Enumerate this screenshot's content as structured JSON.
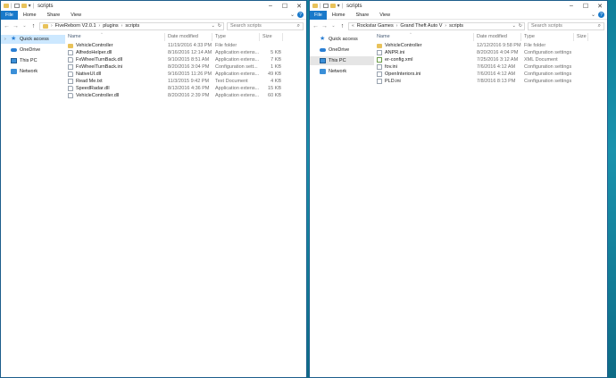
{
  "left": {
    "title": "scripts",
    "tabs": [
      "File",
      "Home",
      "Share",
      "View"
    ],
    "breadcrumb": [
      "FiveReborn V2.0.1",
      "plugins",
      "scripts"
    ],
    "search_placeholder": "Search scripts",
    "nav": [
      {
        "label": "Quick access",
        "icon": "star-icon"
      },
      {
        "label": "OneDrive",
        "icon": "cloud-icon"
      },
      {
        "label": "This PC",
        "icon": "computer-icon"
      },
      {
        "label": "Network",
        "icon": "network-icon"
      }
    ],
    "columns": [
      "Name",
      "Date modified",
      "Type",
      "Size"
    ],
    "files": [
      {
        "name": "VehicleController",
        "date": "11/19/2016 4:33 PM",
        "type": "File folder",
        "size": "",
        "icon": "folder"
      },
      {
        "name": "AlfredoHelper.dll",
        "date": "8/16/2016 12:14 AM",
        "type": "Application extens...",
        "size": "5 KB",
        "icon": "gear"
      },
      {
        "name": "FxWheelTurnBack.dll",
        "date": "9/10/2015 8:51 AM",
        "type": "Application extens...",
        "size": "7 KB",
        "icon": "gear"
      },
      {
        "name": "FxWheelTurnBack.ini",
        "date": "8/20/2016 3:04 PM",
        "type": "Configuration sett...",
        "size": "1 KB",
        "icon": "doc"
      },
      {
        "name": "NativeUI.dll",
        "date": "9/16/2015 11:26 PM",
        "type": "Application extens...",
        "size": "49 KB",
        "icon": "gear"
      },
      {
        "name": "Read Me.txt",
        "date": "11/3/2015 9:42 PM",
        "type": "Text Document",
        "size": "4 KB",
        "icon": "doc"
      },
      {
        "name": "SpeedRadar.dll",
        "date": "8/13/2016 4:36 PM",
        "type": "Application extens...",
        "size": "15 KB",
        "icon": "gear"
      },
      {
        "name": "VehicleController.dll",
        "date": "8/20/2016 2:39 PM",
        "type": "Application extens...",
        "size": "60 KB",
        "icon": "gear"
      }
    ]
  },
  "right": {
    "title": "scripts",
    "tabs": [
      "File",
      "Home",
      "Share",
      "View"
    ],
    "breadcrumb": [
      "Rockstar Games",
      "Grand Theft Auto V",
      "scripts"
    ],
    "search_placeholder": "Search scripts",
    "nav": [
      {
        "label": "Quick access",
        "icon": "star-icon"
      },
      {
        "label": "OneDrive",
        "icon": "cloud-icon"
      },
      {
        "label": "This PC",
        "icon": "computer-icon"
      },
      {
        "label": "Network",
        "icon": "network-icon"
      }
    ],
    "columns": [
      "Name",
      "Date modified",
      "Type",
      "Size"
    ],
    "files": [
      {
        "name": "VehicleController",
        "date": "12/12/2016 9:58 PM",
        "type": "File folder",
        "size": "",
        "icon": "folder"
      },
      {
        "name": "ANPR.ini",
        "date": "8/20/2016 4:04 PM",
        "type": "Configuration settings",
        "size": "",
        "icon": "doc"
      },
      {
        "name": "er-config.xml",
        "date": "7/25/2016 3:12 AM",
        "type": "XML Document",
        "size": "",
        "icon": "xml"
      },
      {
        "name": "fov.ini",
        "date": "7/6/2016 4:12 AM",
        "type": "Configuration settings",
        "size": "",
        "icon": "doc"
      },
      {
        "name": "OpenInteriors.ini",
        "date": "7/6/2016 4:12 AM",
        "type": "Configuration settings",
        "size": "",
        "icon": "doc"
      },
      {
        "name": "PLD.ini",
        "date": "7/8/2016 8:13 PM",
        "type": "Configuration settings",
        "size": "",
        "icon": "doc"
      }
    ]
  },
  "colors": {
    "accent": "#1979ca",
    "selected": "#cce8ff",
    "folder": "#e8c25a"
  }
}
